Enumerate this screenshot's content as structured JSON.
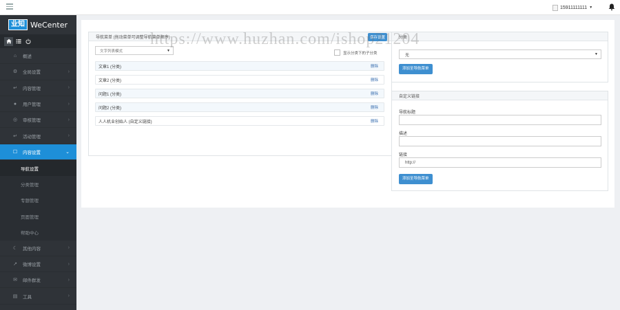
{
  "header": {
    "username": "15911111111",
    "menu_icon": "hamburger-icon",
    "notify_icon": "bell-icon"
  },
  "sidebar": {
    "brand_logo": "业知",
    "brand_name": "WeCenter",
    "quick_buttons": [
      "home-icon",
      "list-icon",
      "power-icon"
    ],
    "items": [
      {
        "label": "概述",
        "icon": "home-icon",
        "chevron": ""
      },
      {
        "label": "全局设置",
        "icon": "gear-icon",
        "chevron": "›"
      },
      {
        "label": "内容管理",
        "icon": "reply-icon",
        "chevron": "›"
      },
      {
        "label": "用户管理",
        "icon": "user-icon",
        "chevron": "›"
      },
      {
        "label": "审核管理",
        "icon": "shield-icon",
        "chevron": "›"
      },
      {
        "label": "活动管理",
        "icon": "reply-icon",
        "chevron": "›"
      },
      {
        "label": "内容设置",
        "icon": "square-icon",
        "chevron": "⌄"
      }
    ],
    "sub_items": [
      "导航设置",
      "分类管理",
      "专题管理",
      "页面管理",
      "帮助中心"
    ],
    "bottom_items": [
      {
        "label": "其他内容",
        "icon": "moon-icon",
        "chevron": "›"
      },
      {
        "label": "微博设置",
        "icon": "share-icon",
        "chevron": "›"
      },
      {
        "label": "邮件群发",
        "icon": "mail-icon",
        "chevron": "›"
      },
      {
        "label": "工具",
        "icon": "briefcase-icon",
        "chevron": "›"
      }
    ]
  },
  "nav_panel": {
    "heading": "导航菜单 (拖动菜单可调整导航菜单顺序)",
    "save_label": "保存设置",
    "mode_select": "文字列表模式",
    "show_sub_label": "显示分类下的子分类",
    "delete_label": "删除",
    "rows": [
      "文章1 (分类)",
      "文章2 (分类)",
      "问题1 (分类)",
      "问题2 (分类)",
      "人人机业创始人 (自定义链接)"
    ]
  },
  "category_panel": {
    "heading": "分类",
    "select_value": "无",
    "add_button": "添加至导航菜单"
  },
  "custom_link_panel": {
    "heading": "自定义链接",
    "title_label": "导航标题",
    "title_value": "",
    "desc_label": "描述",
    "desc_value": "",
    "link_label": "链接",
    "link_value": "http://",
    "add_button": "添加至导航菜单"
  },
  "watermark": "https://www.huzhan.com/ishop21204",
  "colors": {
    "accent": "#1e8fd8",
    "sidebar_bg": "#2f3338",
    "button_blue": "#3e8fd0",
    "page_bg": "#eef0f3"
  }
}
